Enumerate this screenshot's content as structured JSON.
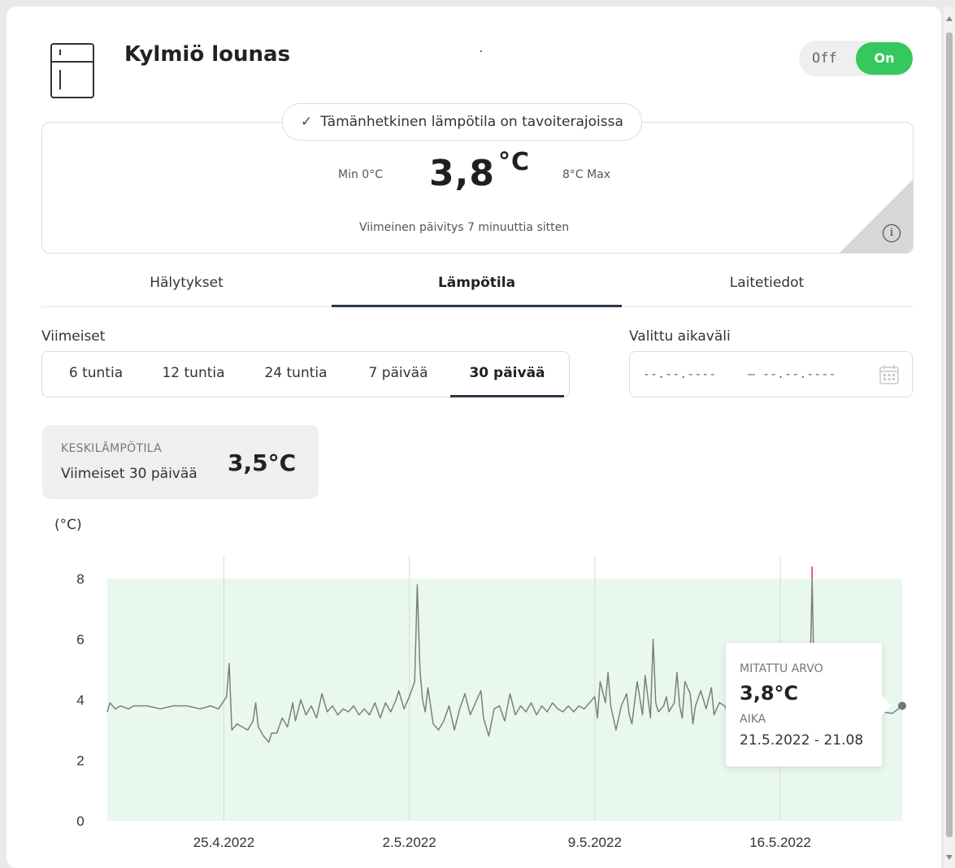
{
  "device": {
    "title": "Kylmiö lounas",
    "icon": "fridge-icon"
  },
  "power_toggle": {
    "off_label": "Off",
    "on_label": "On",
    "state": "On"
  },
  "status": {
    "message": "Tämänhetkinen lämpötila on tavoiterajoissa",
    "min_label": "Min 0°C",
    "max_label": "8°C Max",
    "current_value": "3,8",
    "current_unit": "°C",
    "last_update": "Viimeinen päivitys 7 minuuttia sitten"
  },
  "tabs": [
    {
      "label": "Hälytykset"
    },
    {
      "label": "Lämpötila"
    },
    {
      "label": "Laitetiedot"
    }
  ],
  "active_tab": "Lämpötila",
  "range": {
    "label": "Viimeiset",
    "options": [
      "6 tuntia",
      "12 tuntia",
      "24 tuntia",
      "7 päivää",
      "30 päivää"
    ],
    "selected": "30 päivää"
  },
  "custom_range": {
    "label": "Valittu aikaväli",
    "from_placeholder": "--.--.----",
    "to_placeholder": "– --.--.----"
  },
  "average": {
    "label": "KESKILÄMPÖTILA",
    "period": "Viimeiset 30 päivää",
    "value": "3,5°C"
  },
  "tooltip": {
    "measured_label": "MITATTU ARVO",
    "measured_value": "3,8°C",
    "time_label": "AIKA",
    "time_value": "21.5.2022 - 21.08"
  },
  "colors": {
    "accent_green": "#35c85c",
    "target_band": "#e9f8ee",
    "line": "#7e7e7e",
    "alarm": "#e0303a"
  },
  "chart_data": {
    "type": "line",
    "ylabel": "(°C)",
    "ylim": [
      0,
      8
    ],
    "yticks": [
      0,
      2,
      4,
      6,
      8
    ],
    "xlabels": [
      "25.4.2022",
      "2.5.2022",
      "9.5.2022",
      "16.5.2022"
    ],
    "x_tick_days": [
      4.4,
      11.4,
      18.4,
      25.4
    ],
    "x_range_days": [
      0,
      30
    ],
    "target_band": [
      0,
      8
    ],
    "grid": "vertical",
    "series": [
      {
        "values": [
          [
            0.0,
            3.6
          ],
          [
            0.1,
            3.9
          ],
          [
            0.3,
            3.7
          ],
          [
            0.5,
            3.8
          ],
          [
            0.8,
            3.7
          ],
          [
            1.0,
            3.8
          ],
          [
            1.5,
            3.8
          ],
          [
            2.0,
            3.7
          ],
          [
            2.5,
            3.8
          ],
          [
            3.0,
            3.8
          ],
          [
            3.5,
            3.7
          ],
          [
            3.9,
            3.8
          ],
          [
            4.2,
            3.7
          ],
          [
            4.5,
            4.1
          ],
          [
            4.6,
            5.2
          ],
          [
            4.7,
            3.0
          ],
          [
            4.9,
            3.2
          ],
          [
            5.1,
            3.1
          ],
          [
            5.3,
            3.0
          ],
          [
            5.5,
            3.3
          ],
          [
            5.6,
            3.9
          ],
          [
            5.7,
            3.1
          ],
          [
            5.9,
            2.8
          ],
          [
            6.1,
            2.6
          ],
          [
            6.2,
            2.9
          ],
          [
            6.4,
            2.9
          ],
          [
            6.6,
            3.4
          ],
          [
            6.8,
            3.1
          ],
          [
            7.0,
            3.9
          ],
          [
            7.1,
            3.3
          ],
          [
            7.3,
            4.0
          ],
          [
            7.5,
            3.5
          ],
          [
            7.7,
            3.8
          ],
          [
            7.9,
            3.4
          ],
          [
            8.1,
            4.2
          ],
          [
            8.3,
            3.6
          ],
          [
            8.5,
            3.8
          ],
          [
            8.7,
            3.5
          ],
          [
            8.9,
            3.7
          ],
          [
            9.1,
            3.6
          ],
          [
            9.3,
            3.8
          ],
          [
            9.5,
            3.5
          ],
          [
            9.7,
            3.7
          ],
          [
            9.9,
            3.5
          ],
          [
            10.1,
            3.9
          ],
          [
            10.3,
            3.4
          ],
          [
            10.5,
            3.9
          ],
          [
            10.7,
            3.6
          ],
          [
            10.9,
            4.0
          ],
          [
            11.0,
            4.3
          ],
          [
            11.2,
            3.7
          ],
          [
            11.4,
            4.1
          ],
          [
            11.6,
            4.6
          ],
          [
            11.7,
            7.8
          ],
          [
            11.8,
            5.0
          ],
          [
            11.9,
            4.0
          ],
          [
            12.0,
            3.6
          ],
          [
            12.1,
            4.4
          ],
          [
            12.3,
            3.2
          ],
          [
            12.5,
            3.0
          ],
          [
            12.7,
            3.3
          ],
          [
            12.9,
            3.8
          ],
          [
            13.1,
            3.0
          ],
          [
            13.3,
            3.7
          ],
          [
            13.5,
            4.2
          ],
          [
            13.7,
            3.5
          ],
          [
            13.9,
            3.9
          ],
          [
            14.1,
            4.3
          ],
          [
            14.2,
            3.4
          ],
          [
            14.4,
            2.8
          ],
          [
            14.6,
            3.7
          ],
          [
            14.8,
            3.8
          ],
          [
            15.0,
            3.3
          ],
          [
            15.2,
            4.2
          ],
          [
            15.4,
            3.5
          ],
          [
            15.6,
            3.8
          ],
          [
            15.8,
            3.6
          ],
          [
            16.0,
            3.9
          ],
          [
            16.2,
            3.5
          ],
          [
            16.4,
            3.8
          ],
          [
            16.6,
            3.6
          ],
          [
            16.8,
            3.9
          ],
          [
            17.0,
            3.7
          ],
          [
            17.2,
            3.6
          ],
          [
            17.4,
            3.8
          ],
          [
            17.6,
            3.6
          ],
          [
            17.8,
            3.8
          ],
          [
            18.0,
            3.7
          ],
          [
            18.2,
            3.9
          ],
          [
            18.4,
            4.1
          ],
          [
            18.5,
            3.4
          ],
          [
            18.6,
            4.6
          ],
          [
            18.8,
            3.9
          ],
          [
            18.9,
            4.9
          ],
          [
            19.0,
            3.8
          ],
          [
            19.2,
            3.0
          ],
          [
            19.3,
            3.4
          ],
          [
            19.4,
            3.8
          ],
          [
            19.6,
            4.2
          ],
          [
            19.7,
            3.5
          ],
          [
            19.8,
            3.2
          ],
          [
            20.0,
            4.6
          ],
          [
            20.2,
            3.5
          ],
          [
            20.3,
            4.8
          ],
          [
            20.5,
            3.4
          ],
          [
            20.6,
            6.0
          ],
          [
            20.7,
            3.9
          ],
          [
            20.8,
            3.6
          ],
          [
            21.0,
            3.8
          ],
          [
            21.1,
            4.1
          ],
          [
            21.2,
            3.6
          ],
          [
            21.4,
            3.9
          ],
          [
            21.5,
            4.9
          ],
          [
            21.6,
            3.8
          ],
          [
            21.7,
            3.4
          ],
          [
            21.8,
            4.6
          ],
          [
            22.0,
            4.2
          ],
          [
            22.1,
            3.2
          ],
          [
            22.2,
            3.8
          ],
          [
            22.4,
            4.3
          ],
          [
            22.6,
            3.7
          ],
          [
            22.8,
            4.4
          ],
          [
            22.9,
            3.5
          ],
          [
            23.1,
            3.9
          ],
          [
            23.3,
            3.8
          ],
          [
            23.5,
            3.4
          ],
          [
            23.7,
            3.6
          ],
          [
            23.9,
            3.2
          ],
          [
            24.1,
            3.5
          ],
          [
            24.3,
            3.4
          ],
          [
            24.5,
            3.3
          ],
          [
            24.7,
            3.3
          ],
          [
            24.9,
            3.4
          ],
          [
            25.1,
            3.3
          ],
          [
            25.3,
            3.4
          ],
          [
            25.5,
            3.4
          ],
          [
            25.7,
            3.3
          ],
          [
            25.9,
            3.4
          ],
          [
            26.1,
            3.5
          ],
          [
            26.3,
            3.4
          ],
          [
            26.5,
            3.7
          ],
          [
            26.6,
            8.0
          ],
          [
            26.7,
            3.6
          ],
          [
            26.9,
            3.6
          ],
          [
            27.1,
            3.7
          ],
          [
            27.4,
            3.7
          ],
          [
            27.6,
            3.8
          ]
        ]
      }
    ],
    "alarm_points": [
      [
        26.6,
        8.4
      ]
    ],
    "selected_point": [
      30.0,
      3.8
    ]
  }
}
